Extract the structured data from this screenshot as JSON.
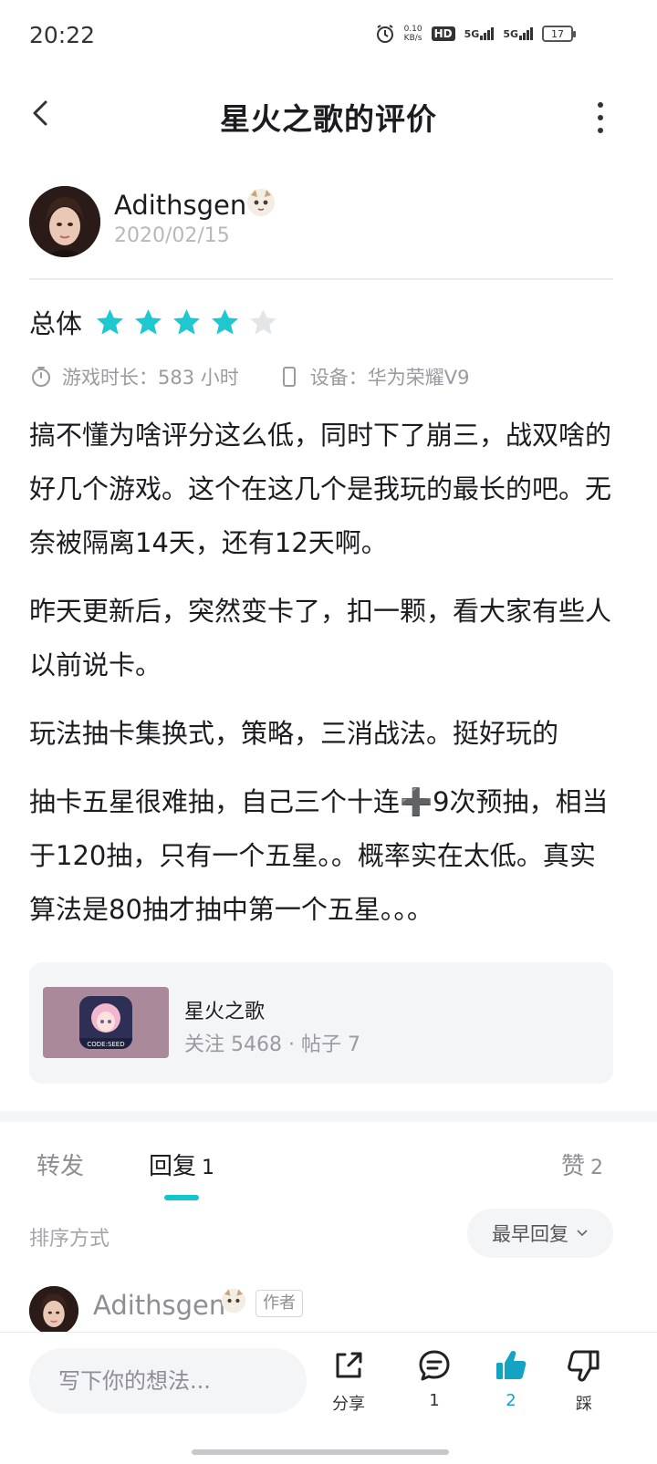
{
  "status_bar": {
    "time": "20:22",
    "net_speed": "0.10",
    "net_unit": "KB/s",
    "hd": "HD",
    "sim1": "5G",
    "sim2": "5G",
    "battery": "17"
  },
  "nav": {
    "title": "星火之歌的评价"
  },
  "author": {
    "name": "Adithsgen",
    "date": "2020/02/15"
  },
  "rating": {
    "label": "总体",
    "value": 4,
    "max": 5,
    "star_color": "#1fc8cf",
    "empty_star_color": "#e3e6e8"
  },
  "meta": {
    "playtime": "游戏时长：583 小时",
    "device": "设备：华为荣耀V9"
  },
  "review": {
    "paragraphs": [
      "搞不懂为啥评分这么低，同时下了崩三，战双啥的好几个游戏。这个在这几个是我玩的最长的吧。无奈被隔离14天，还有12天啊。",
      "昨天更新后，突然变卡了，扣一颗，看大家有些人以前说卡。",
      "玩法抽卡集换式，策略，三消战法。挺好玩的",
      "抽卡五星很难抽，自己三个十连➕9次预抽，相当于120抽，只有一个五星。。概率实在太低。真实算法是80抽才抽中第一个五星。。。"
    ]
  },
  "game_card": {
    "name": "星火之歌",
    "stats": "关注 5468  · 帖子 7",
    "icon_label": "CODE:SEED"
  },
  "tabs": {
    "forward": "转发",
    "reply": "回复",
    "reply_count": "1",
    "like": "赞",
    "like_count": "2"
  },
  "sort": {
    "label": "排序方式",
    "selected": "最早回复"
  },
  "reply": {
    "name": "Adithsgen",
    "tag": "作者"
  },
  "bottom_bar": {
    "placeholder": "写下你的想法...",
    "share": "分享",
    "comment_count": "1",
    "like_count": "2",
    "dislike": "踩",
    "accent": "#15a3c4"
  }
}
